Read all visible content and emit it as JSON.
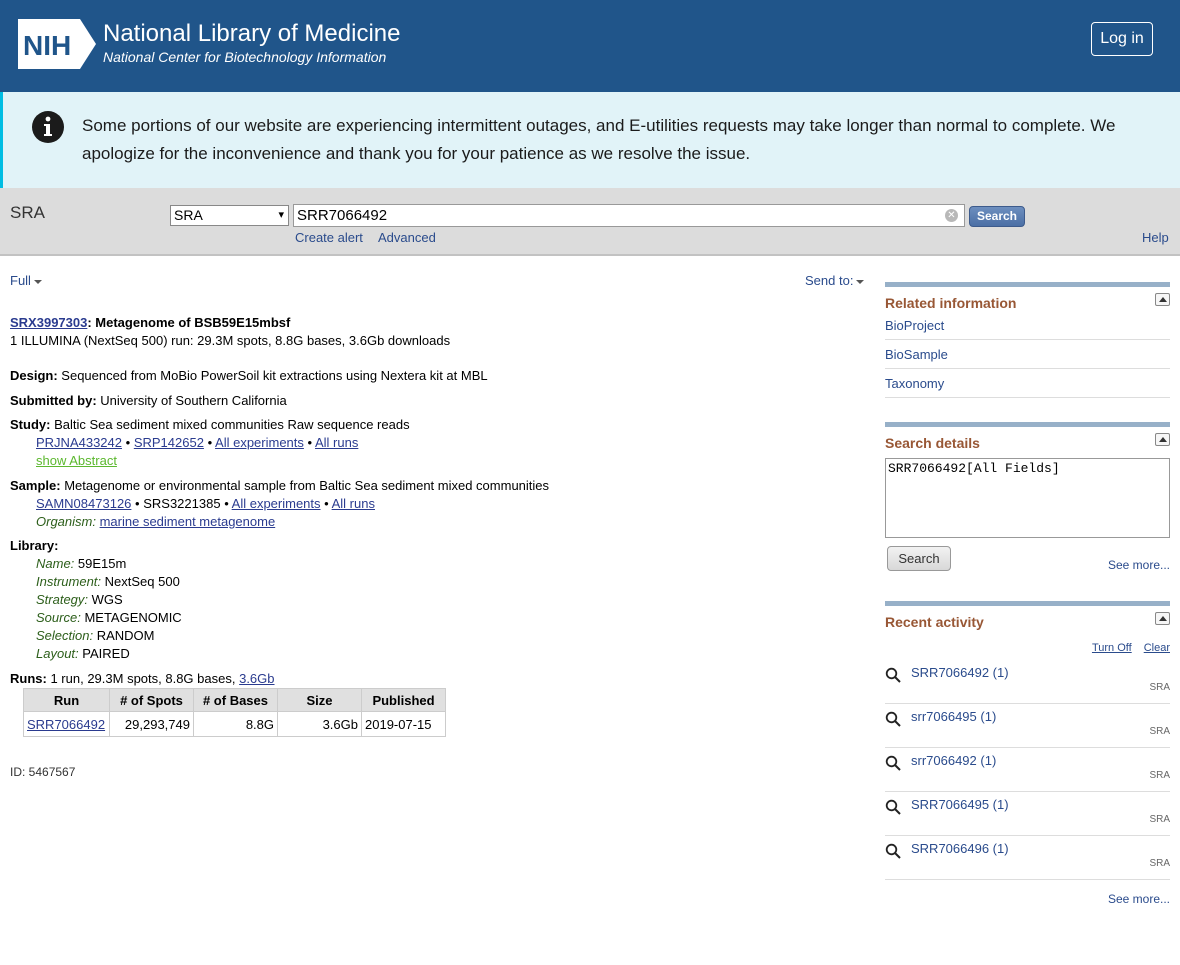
{
  "header": {
    "logo_text": "NIH",
    "title": "National Library of Medicine",
    "subtitle": "National Center for Biotechnology Information",
    "login_label": "Log in"
  },
  "banner": {
    "text": "Some portions of our website are experiencing intermittent outages, and E-utilities requests may take longer than normal to complete. We apologize for the inconvenience and thank you for your patience as we resolve the issue."
  },
  "search": {
    "db_label": "SRA",
    "db_selected": "SRA",
    "term": "SRR7066492",
    "button": "Search",
    "create_alert": "Create alert",
    "advanced": "Advanced",
    "help": "Help"
  },
  "toolbar": {
    "format": "Full",
    "send_to": "Send to:"
  },
  "record": {
    "accession": "SRX3997303",
    "title": ": Metagenome of BSB59E15mbsf",
    "summary": "1 ILLUMINA (NextSeq 500) run: 29.3M spots, 8.8G bases, 3.6Gb downloads",
    "design_label": "Design:",
    "design": "Sequenced from MoBio PowerSoil kit extractions using Nextera kit at MBL",
    "submitted_label": "Submitted by:",
    "submitted_by": "University of Southern California",
    "study_label": "Study:",
    "study": "Baltic Sea sediment mixed communities Raw sequence reads",
    "study_links": {
      "bioproject": "PRJNA433242",
      "srp": "SRP142652",
      "all_experiments": "All experiments",
      "all_runs": "All runs",
      "sep": "•"
    },
    "show_abstract": "show Abstract",
    "sample_label": "Sample:",
    "sample": "Metagenome or environmental sample from Baltic Sea sediment mixed communities",
    "sample_links": {
      "biosample": "SAMN08473126",
      "srs": "SRS3221385",
      "all_experiments": "All experiments",
      "all_runs": "All runs"
    },
    "organism_label": "Organism:",
    "organism": "marine sediment metagenome",
    "library_label": "Library:",
    "library": [
      {
        "label": "Name:",
        "value": "59E15m"
      },
      {
        "label": "Instrument:",
        "value": "NextSeq 500"
      },
      {
        "label": "Strategy:",
        "value": "WGS"
      },
      {
        "label": "Source:",
        "value": "METAGENOMIC"
      },
      {
        "label": "Selection:",
        "value": "RANDOM"
      },
      {
        "label": "Layout:",
        "value": "PAIRED"
      }
    ],
    "runs_label": "Runs:",
    "runs_summary": "1 run, 29.3M spots, 8.8G bases,",
    "runs_size_link": "3.6Gb",
    "runs_table": {
      "headers": [
        "Run",
        "# of Spots",
        "# of Bases",
        "Size",
        "Published"
      ],
      "rows": [
        [
          "SRR7066492",
          "29,293,749",
          "8.8G",
          "3.6Gb",
          "2019-07-15"
        ]
      ]
    },
    "id_text": "ID: 5467567"
  },
  "sidebar": {
    "related_title": "Related information",
    "related_items": [
      "BioProject",
      "BioSample",
      "Taxonomy"
    ],
    "search_details_title": "Search details",
    "search_details_query": "SRR7066492[All Fields]",
    "search_details_button": "Search",
    "search_details_see_more": "See more...",
    "recent_title": "Recent activity",
    "recent_turn_off": "Turn Off",
    "recent_clear": "Clear",
    "recent_items": [
      {
        "term": "SRR7066492 (1)",
        "db": "SRA"
      },
      {
        "term": "srr7066495 (1)",
        "db": "SRA"
      },
      {
        "term": "srr7066492 (1)",
        "db": "SRA"
      },
      {
        "term": "SRR7066495 (1)",
        "db": "SRA"
      },
      {
        "term": "SRR7066496 (1)",
        "db": "SRA"
      }
    ],
    "recent_see_more": "See more..."
  },
  "colors": {
    "header_bg": "#20558a",
    "banner_bg": "#e1f3f8",
    "banner_accent": "#00bde3",
    "portlet_title": "#985735",
    "link": "#2a3b8f"
  }
}
